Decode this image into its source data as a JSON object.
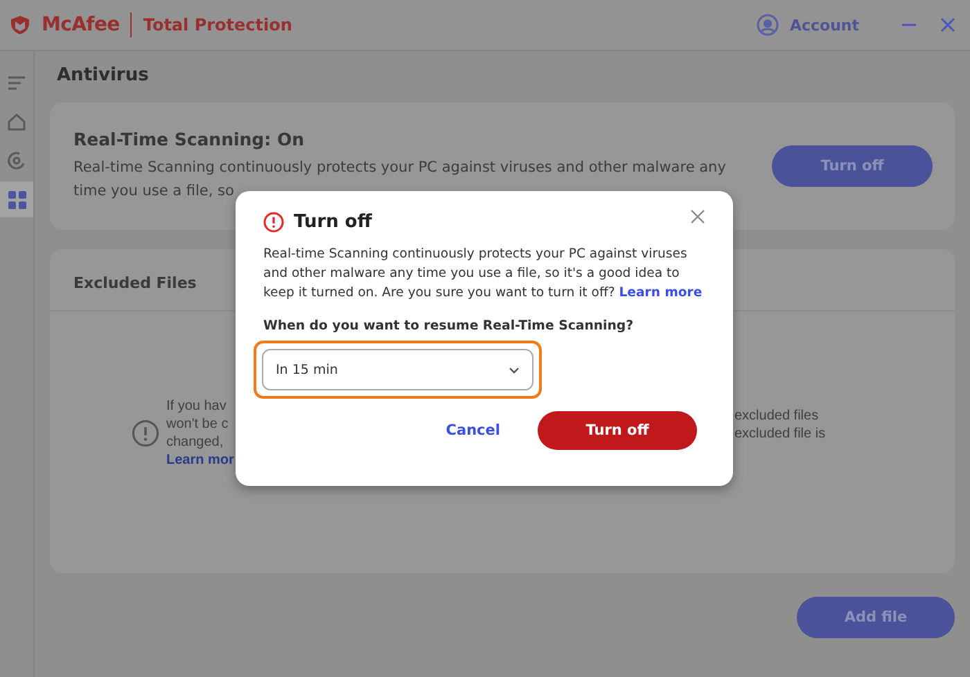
{
  "app": {
    "brand": "McAfee",
    "product": "Total Protection",
    "account": "Account"
  },
  "sidebar": {
    "items": [
      {
        "kind": "menu",
        "selected": false
      },
      {
        "kind": "home",
        "selected": false
      },
      {
        "kind": "scan",
        "selected": false
      },
      {
        "kind": "apps",
        "selected": true
      }
    ]
  },
  "page_title": "Antivirus",
  "realtime_card": {
    "title": "Real-Time Scanning: On",
    "description": "Real-time Scanning continuously protects your PC against viruses and other malware any time you use a file, so",
    "button": "Turn off"
  },
  "excluded_card": {
    "title": "Excluded Files",
    "left_lines": [
      "If you hav",
      "won't be c",
      "changed,"
    ],
    "left_link": "Learn mor",
    "right_lines": [
      "excluded files",
      "excluded file is"
    ]
  },
  "add_button": "Add file",
  "dialog": {
    "title": "Turn off",
    "body": "Real-time Scanning continuously protects your PC against viruses and other malware any time you use a file, so it's a good idea to keep it turned on. Are you sure you want to turn it off?",
    "link": "Learn more",
    "question": "When do you want to resume Real-Time Scanning?",
    "select": {
      "value": "In 15 min",
      "highlighted": true
    },
    "cancel": "Cancel",
    "confirm": "Turn off"
  }
}
